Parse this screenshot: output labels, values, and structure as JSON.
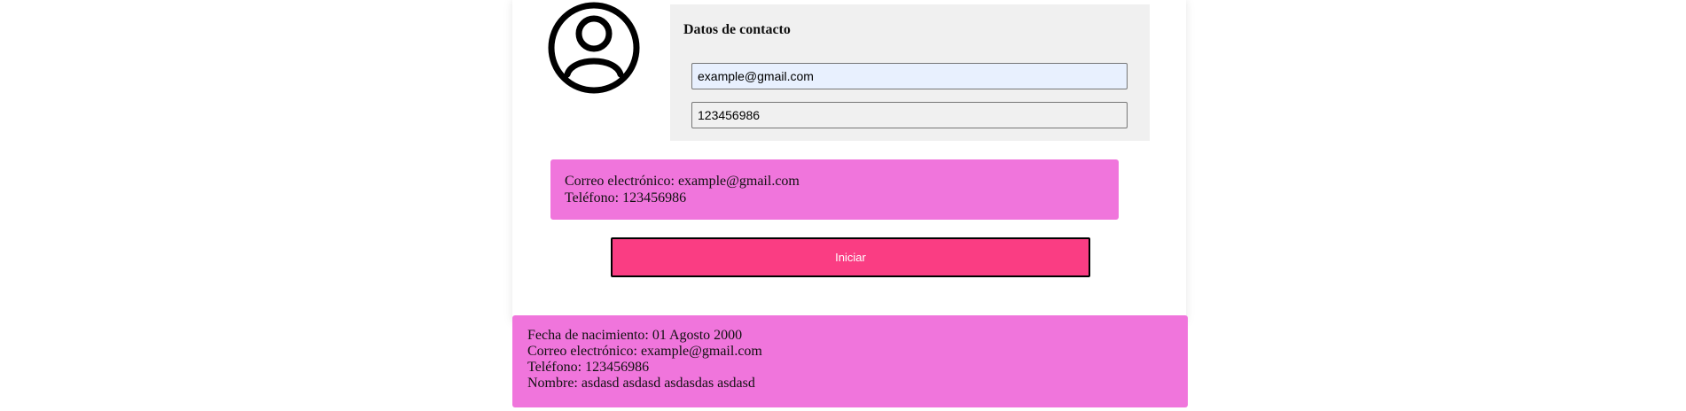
{
  "avatar": {
    "icon": "user-circle-icon"
  },
  "contact": {
    "title": "Datos de contacto",
    "email_value": "example@gmail.com",
    "phone_value": "123456986"
  },
  "summary": {
    "email_line": "Correo electrónico: example@gmail.com",
    "phone_line": "Teléfono: 123456986"
  },
  "start_button": {
    "label": "Iniciar"
  },
  "full_summary": {
    "birth_line": "Fecha de nacimiento: 01 Agosto 2000",
    "email_line": "Correo electrónico: example@gmail.com",
    "phone_line": "Teléfono: 123456986",
    "name_line": "Nombre: asdasd asdasd asdasdas asdasd"
  },
  "colors": {
    "summary_bg": "#f075dc",
    "button_bg": "#fa3d83",
    "card_bg": "#f0f0f0",
    "autofill_bg": "#e8f0fe"
  }
}
